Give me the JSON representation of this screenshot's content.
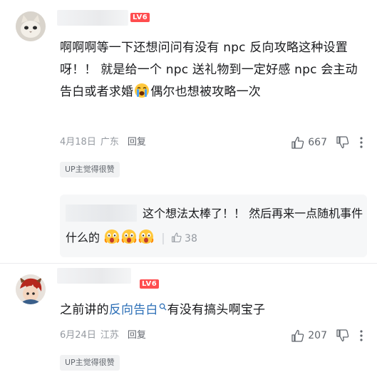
{
  "comment1": {
    "level_badge": "LV6",
    "text_part1": "啊啊啊等一下还想问问有没有 npc 反向攻略这种设置呀！！ 就是给一个 npc 送礼物到一定好感 npc 会主动告白或者求婚",
    "text_part2": "偶尔也想被攻略一次",
    "date": "4月18日",
    "location": "广东",
    "reply_label": "回复",
    "like_count": "667",
    "up_tag": "UP主觉得很赞"
  },
  "subreply": {
    "text": "这个想法太棒了！！ 然后再来一点随机事件什么的",
    "like_count": "38"
  },
  "comment2": {
    "level_badge": "LV6",
    "text_before": "之前讲的",
    "link_text": "反向告白",
    "text_after": "有没有搞头啊宝子",
    "date": "6月24日",
    "location": "江苏",
    "reply_label": "回复",
    "like_count": "207",
    "up_tag": "UP主觉得很赞"
  },
  "colors": {
    "level_badge": "#ff4d4f",
    "link": "#2c6fb7",
    "meta_text": "#9499a0"
  },
  "icons": [
    "thumbs-up-icon",
    "thumbs-down-icon",
    "more-icon",
    "search-icon",
    "crying-emoji",
    "scared-emoji"
  ]
}
